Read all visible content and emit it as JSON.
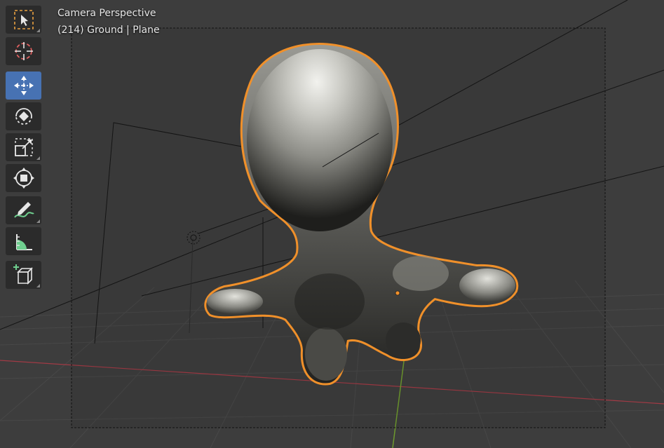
{
  "viewport": {
    "view_mode": "Camera Perspective",
    "object_info": "(214) Ground | Plane"
  },
  "toolbar": {
    "tools": [
      {
        "name": "select-box-tool",
        "icon": "select-box-icon",
        "active": false
      },
      {
        "name": "cursor-tool",
        "icon": "cursor-icon",
        "active": false
      },
      {
        "name": "move-tool",
        "icon": "move-icon",
        "active": true
      },
      {
        "name": "rotate-tool",
        "icon": "rotate-icon",
        "active": false
      },
      {
        "name": "scale-tool",
        "icon": "scale-icon",
        "active": false
      },
      {
        "name": "transform-tool",
        "icon": "transform-icon",
        "active": false
      },
      {
        "name": "annotate-tool",
        "icon": "annotate-icon",
        "active": false
      },
      {
        "name": "measure-tool",
        "icon": "measure-icon",
        "active": false
      },
      {
        "name": "add-cube-tool",
        "icon": "add-cube-icon",
        "active": false
      }
    ]
  },
  "colors": {
    "background": "#3d3d3d",
    "active_tool": "#4772b3",
    "selection_outline": "#f0902a",
    "x_axis": "#a13a45",
    "y_axis": "#6e9a2e"
  }
}
